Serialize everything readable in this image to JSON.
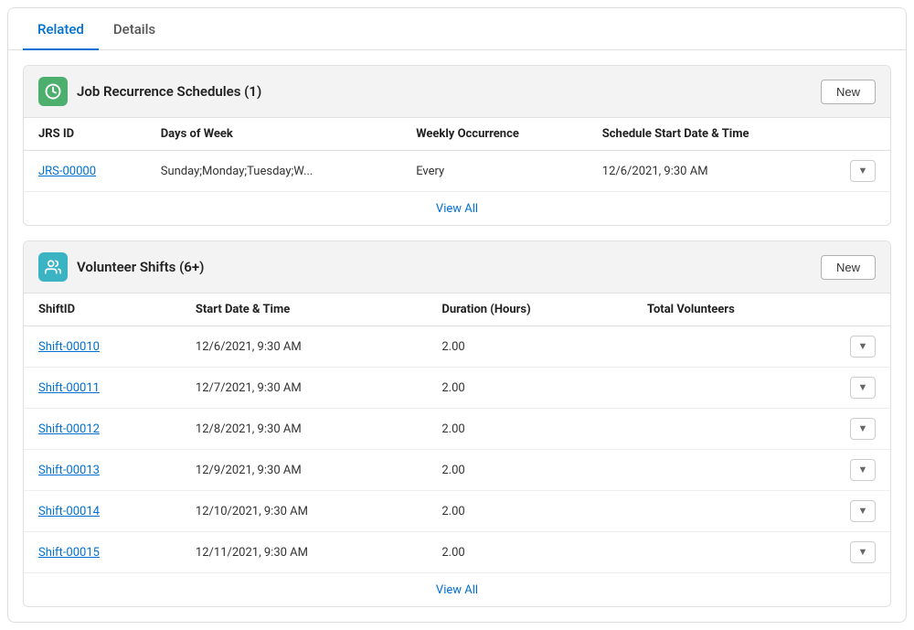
{
  "tabs": [
    {
      "id": "related",
      "label": "Related",
      "active": true
    },
    {
      "id": "details",
      "label": "Details",
      "active": false
    }
  ],
  "sections": [
    {
      "id": "jrs",
      "icon": "clock",
      "icon_class": "icon-green",
      "title": "Job Recurrence Schedules (1)",
      "new_label": "New",
      "columns": [
        "JRS ID",
        "Days of Week",
        "Weekly Occurrence",
        "Schedule Start Date & Time"
      ],
      "rows": [
        {
          "cells": [
            "JRS-00000",
            "Sunday;Monday;Tuesday;W...",
            "Every",
            "12/6/2021, 9:30 AM"
          ],
          "link_col": 0
        }
      ],
      "view_all": "View All"
    },
    {
      "id": "volunteer",
      "icon": "people",
      "icon_class": "icon-teal",
      "title": "Volunteer Shifts (6+)",
      "new_label": "New",
      "columns": [
        "ShiftID",
        "Start Date & Time",
        "Duration (Hours)",
        "Total Volunteers"
      ],
      "rows": [
        {
          "cells": [
            "Shift-00010",
            "12/6/2021, 9:30 AM",
            "2.00",
            ""
          ],
          "link_col": 0
        },
        {
          "cells": [
            "Shift-00011",
            "12/7/2021, 9:30 AM",
            "2.00",
            ""
          ],
          "link_col": 0
        },
        {
          "cells": [
            "Shift-00012",
            "12/8/2021, 9:30 AM",
            "2.00",
            ""
          ],
          "link_col": 0
        },
        {
          "cells": [
            "Shift-00013",
            "12/9/2021, 9:30 AM",
            "2.00",
            ""
          ],
          "link_col": 0
        },
        {
          "cells": [
            "Shift-00014",
            "12/10/2021, 9:30 AM",
            "2.00",
            ""
          ],
          "link_col": 0
        },
        {
          "cells": [
            "Shift-00015",
            "12/11/2021, 9:30 AM",
            "2.00",
            ""
          ],
          "link_col": 0
        }
      ],
      "view_all": "View All"
    }
  ]
}
